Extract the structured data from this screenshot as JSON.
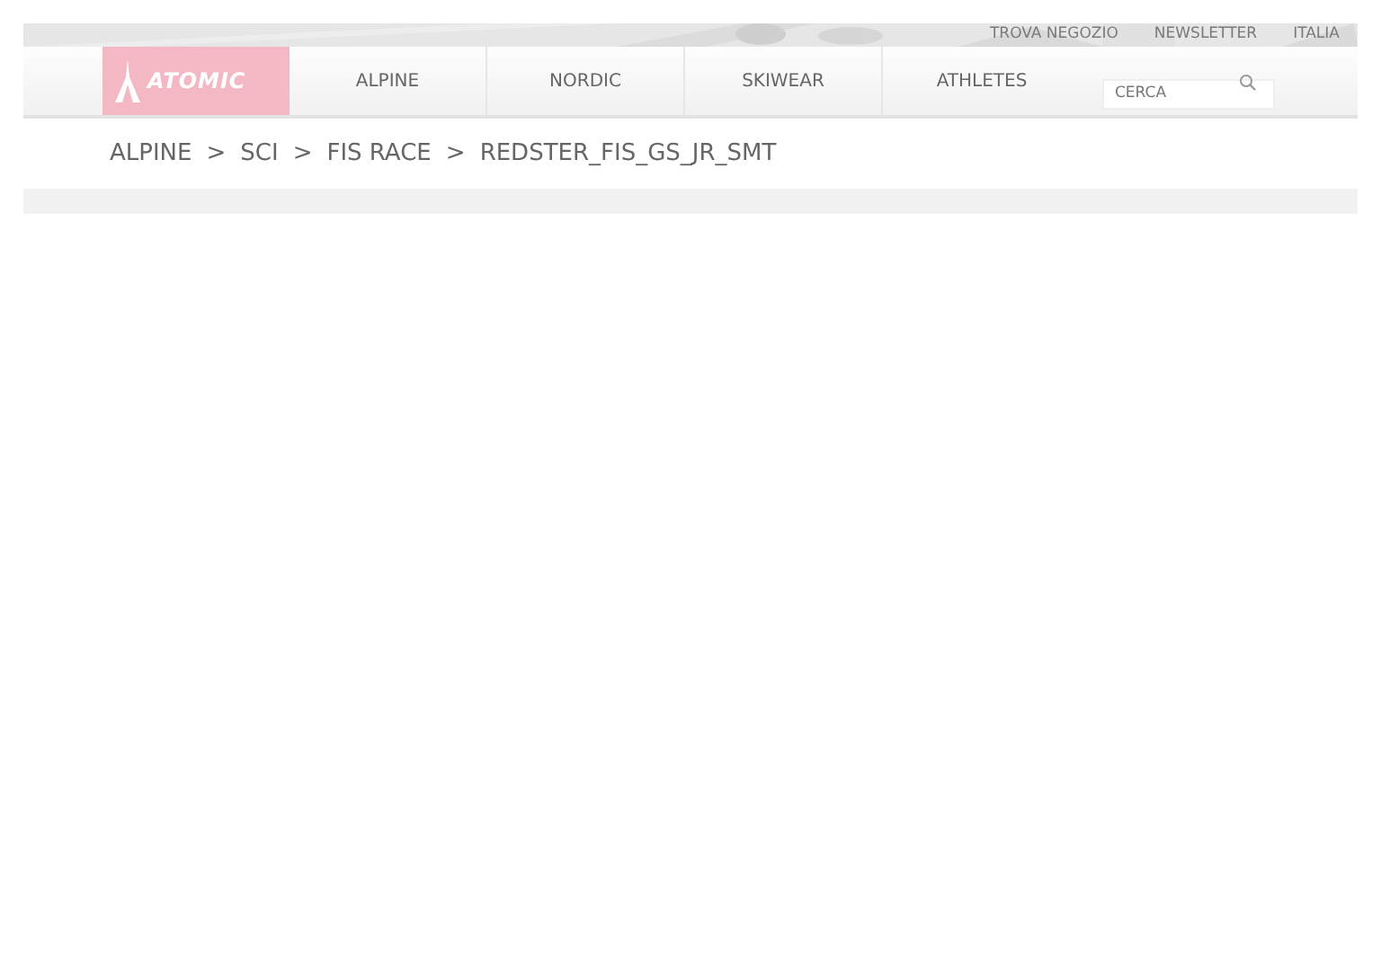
{
  "top_links": [
    "TROVA NEGOZIO",
    "NEWSLETTER",
    "ITALIA"
  ],
  "logo": {
    "text": "ATOMIC"
  },
  "nav": [
    {
      "label": "ALPINE"
    },
    {
      "label": "NORDIC"
    },
    {
      "label": "SKIWEAR"
    },
    {
      "label": "ATHLETES"
    }
  ],
  "search": {
    "placeholder": "CERCA"
  },
  "breadcrumb": [
    {
      "label": "ALPINE"
    },
    {
      "label": "SCI"
    },
    {
      "label": "FIS RACE"
    },
    {
      "label": "REDSTER_FIS_GS_JR_SMT"
    }
  ],
  "breadcrumb_separator": ">"
}
